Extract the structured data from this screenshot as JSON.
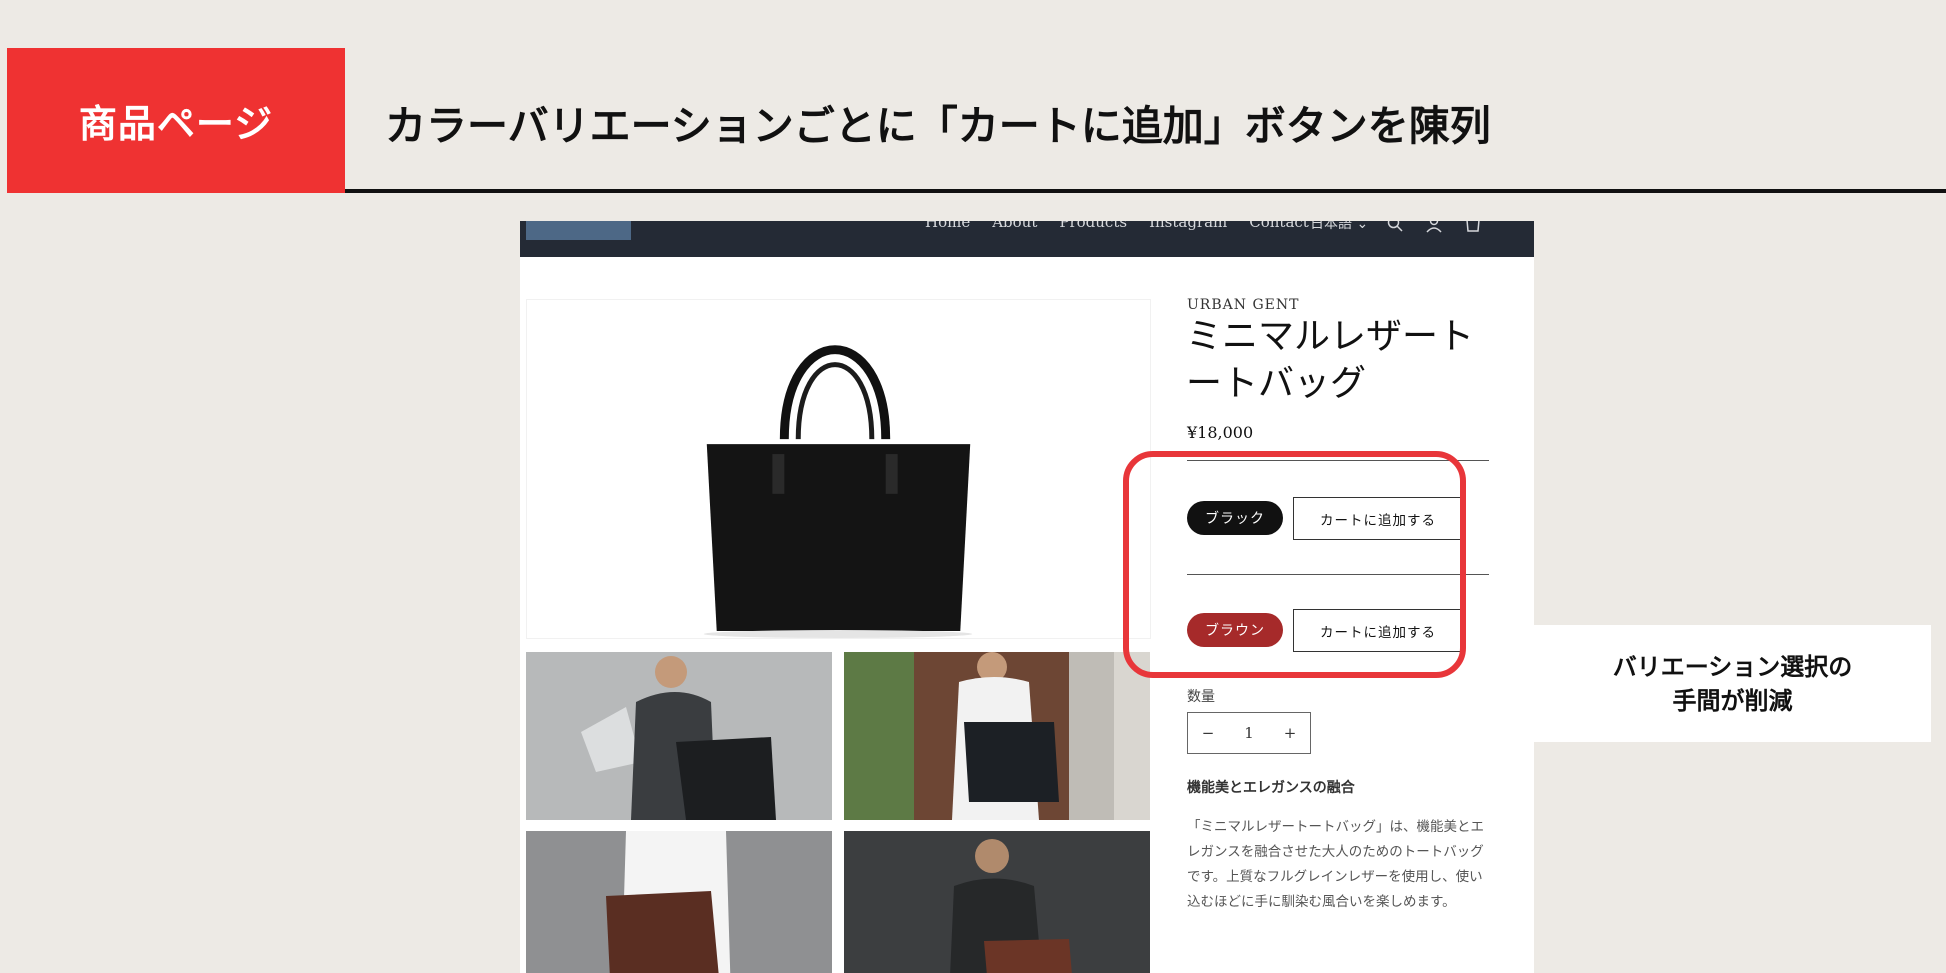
{
  "slide": {
    "tag": "商品ページ",
    "headline": "カラーバリエーションごとに「カートに追加」ボタンを陳列",
    "callout_line1": "バリエーション選択の",
    "callout_line2": "手間が削減"
  },
  "store": {
    "nav": {
      "links": [
        "Home",
        "About",
        "Products",
        "Instagram",
        "Contact"
      ],
      "language": "日本語",
      "icons": [
        "search-icon",
        "account-icon",
        "cart-icon"
      ]
    },
    "product": {
      "vendor": "URBAN GENT",
      "title": "ミニマルレザートートバッグ",
      "price": "¥18,000",
      "variants": [
        {
          "color_label": "ブラック",
          "swatch_color": "#111111",
          "cart_label": "カートに追加する"
        },
        {
          "color_label": "ブラウン",
          "swatch_color": "#a62a2a",
          "cart_label": "カートに追加する"
        }
      ],
      "quantity_label": "数量",
      "quantity": "1",
      "minus": "−",
      "plus": "+",
      "desc_heading": "機能美とエレガンスの融合",
      "description": "「ミニマルレザートートバッグ」は、機能美とエレガンスを融合させた大人のためのトートバッグです。上質なフルグレインレザーを使用し、使い込むほどに手に馴染む風合いを楽しめます。"
    }
  },
  "colors": {
    "accent_red": "#ef3232",
    "highlight_red": "#e8363a",
    "nav_bg": "#242a35"
  }
}
